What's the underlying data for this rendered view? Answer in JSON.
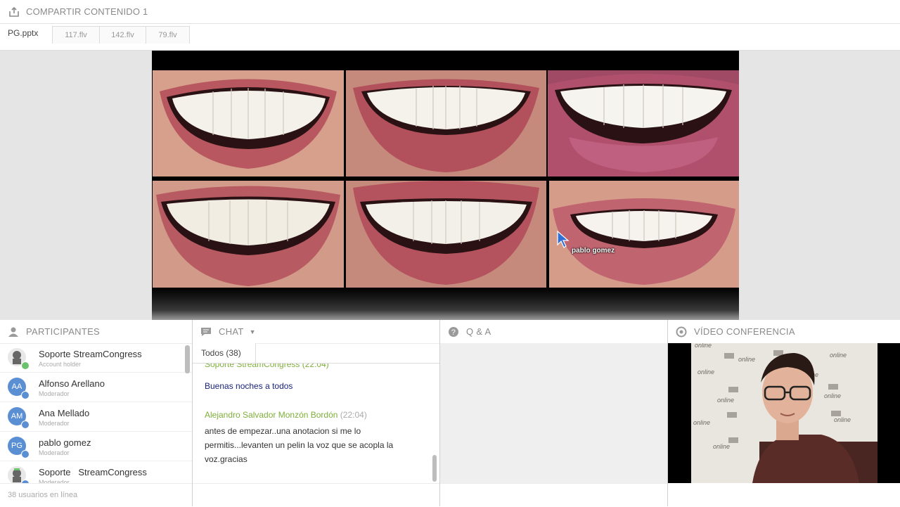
{
  "header": {
    "title": "COMPARTIR CONTENIDO 1",
    "icon": "share-icon"
  },
  "tabs": {
    "current": "PG.pptx",
    "files": [
      "117.flv",
      "142.flv",
      "79.flv"
    ]
  },
  "presentation": {
    "cursor_label": "pablo gomez"
  },
  "participants": {
    "title": "PARTICIPANTES",
    "items": [
      {
        "name": "Soporte StreamCongress",
        "role": "Account holder",
        "initials": ""
      },
      {
        "name": "Alfonso Arellano",
        "role": "Moderador",
        "initials": "AA"
      },
      {
        "name": "Ana Mellado",
        "role": "Moderador",
        "initials": "AM"
      },
      {
        "name": "pablo gomez",
        "role": "Moderador",
        "initials": "PG"
      },
      {
        "name": "Soporte   StreamCongress",
        "role": "Moderador",
        "initials": ""
      }
    ],
    "online": "38 usuarios en línea"
  },
  "chat": {
    "title": "CHAT",
    "tab": "Todos (38)",
    "messages": [
      {
        "author": "",
        "text": "Buenas noches a todos"
      },
      {
        "author": "Alejandro Salvador Monzón Bordón",
        "time": "(22:04)",
        "text": "antes de empezar..una anotacion si me lo permitis...levanten un pelin la voz que se acopla la voz.gracias"
      }
    ]
  },
  "qa": {
    "title": "Q & A"
  },
  "video": {
    "title": "VÍDEO CONFERENCIA",
    "backdrop_word": "online"
  },
  "colors": {
    "accent_green": "#7fae3a",
    "avatar_blue": "#5b8fd3",
    "link_navy": "#1a237e"
  }
}
